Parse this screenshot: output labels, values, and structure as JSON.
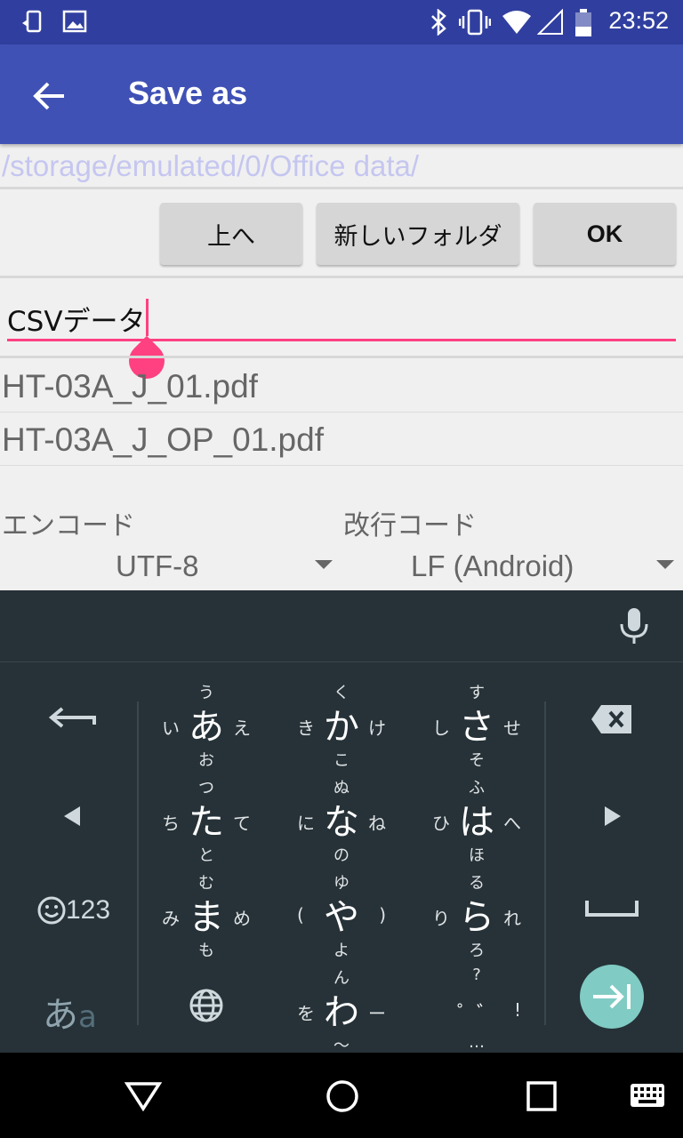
{
  "status_bar": {
    "time": "23:52",
    "icons": [
      "screen-rotation-icon",
      "image-icon",
      "bluetooth-icon",
      "vibrate-icon",
      "wifi-icon",
      "signal-icon",
      "battery-icon"
    ]
  },
  "app_bar": {
    "title": "Save as",
    "back_icon": "arrow-back-icon"
  },
  "path": "/storage/emulated/0/Office data/",
  "buttons": {
    "up": "上へ",
    "new_folder": "新しいフォルダ",
    "ok": "OK"
  },
  "filename": {
    "value": "CSVデータ"
  },
  "files": [
    "HT-03A_J_01.pdf",
    "HT-03A_J_OP_01.pdf"
  ],
  "encoding": {
    "label": "エンコード",
    "value": "UTF-8"
  },
  "newline": {
    "label": "改行コード",
    "value": "LF (Android)"
  },
  "keyboard": {
    "rows": [
      [
        {
          "main": "あ",
          "top": "う",
          "left": "い",
          "right": "え",
          "bottom": "お"
        },
        {
          "main": "か",
          "top": "く",
          "left": "き",
          "right": "け",
          "bottom": "こ"
        },
        {
          "main": "さ",
          "top": "す",
          "left": "し",
          "right": "せ",
          "bottom": "そ"
        }
      ],
      [
        {
          "main": "た",
          "top": "つ",
          "left": "ち",
          "right": "て",
          "bottom": "と"
        },
        {
          "main": "な",
          "top": "ぬ",
          "left": "に",
          "right": "ね",
          "bottom": "の"
        },
        {
          "main": "は",
          "top": "ふ",
          "left": "ひ",
          "right": "へ",
          "bottom": "ほ"
        }
      ],
      [
        {
          "main": "ま",
          "top": "む",
          "left": "み",
          "right": "め",
          "bottom": "も"
        },
        {
          "main": "や",
          "top": "ゆ",
          "left": "(",
          "right": ")",
          "bottom": "よ"
        },
        {
          "main": "ら",
          "top": "る",
          "left": "り",
          "right": "れ",
          "bottom": "ろ"
        }
      ],
      [
        {
          "main": "わ",
          "top": "ん",
          "left": "を",
          "right": "ー",
          "bottom": "〜"
        },
        {
          "main": "゜゛",
          "top": "?",
          "left": "",
          "right": "!",
          "bottom": "…"
        }
      ]
    ],
    "num_label": "123",
    "mode_label_main": "あ",
    "mode_label_sub": "a",
    "accent": "#80cbc4"
  },
  "colors": {
    "app_bar": "#3f51b5",
    "status_bar": "#303f9f",
    "accent": "#ff4081"
  }
}
